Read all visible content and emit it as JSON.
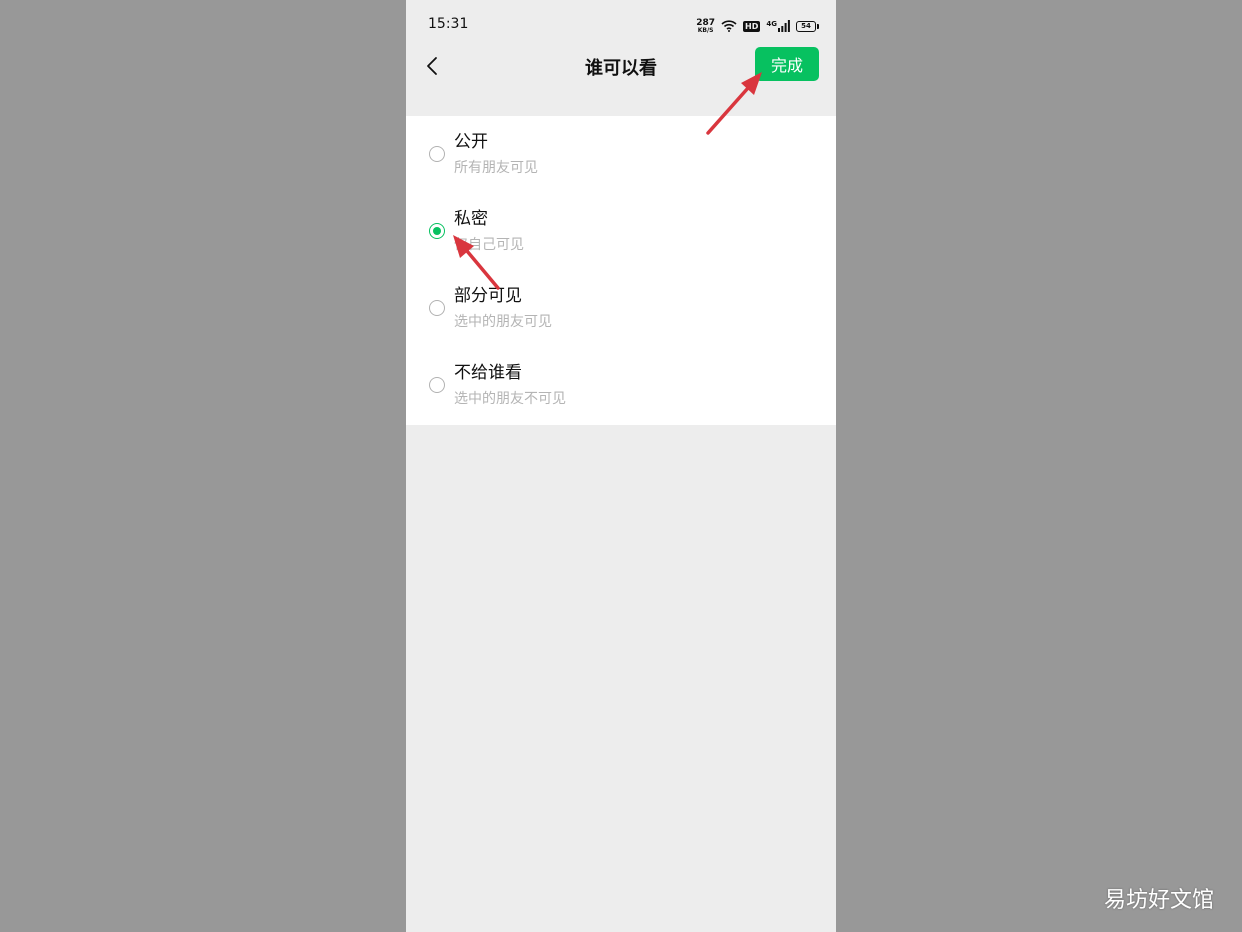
{
  "status_bar": {
    "time": "15:31",
    "net_speed_value": "287",
    "net_speed_unit": "KB/S",
    "hd_label": "HD",
    "network_type": "4G",
    "battery_level": "54"
  },
  "nav": {
    "title": "谁可以看",
    "done_label": "完成"
  },
  "options": [
    {
      "title": "公开",
      "subtitle": "所有朋友可见",
      "selected": false
    },
    {
      "title": "私密",
      "subtitle": "仅自己可见",
      "selected": true
    },
    {
      "title": "部分可见",
      "subtitle": "选中的朋友可见",
      "selected": false
    },
    {
      "title": "不给谁看",
      "subtitle": "选中的朋友不可见",
      "selected": false
    }
  ],
  "colors": {
    "accent": "#07c160",
    "annotation_arrow": "#d9363e"
  },
  "watermark": "易坊好文馆"
}
